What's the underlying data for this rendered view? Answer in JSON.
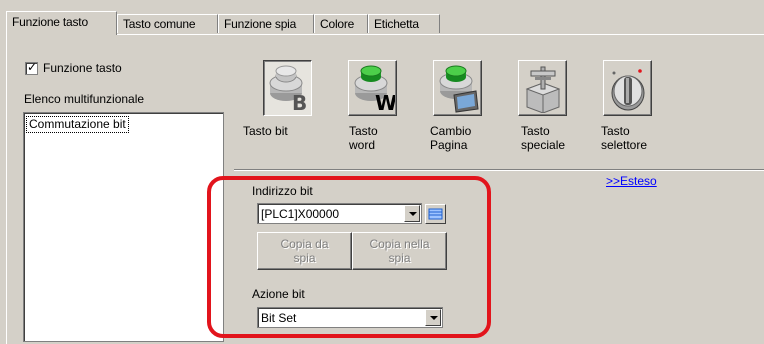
{
  "tabs": [
    {
      "label": "Funzione tasto",
      "active": true
    },
    {
      "label": "Tasto comune",
      "active": false
    },
    {
      "label": "Funzione spia",
      "active": false
    },
    {
      "label": "Colore",
      "active": false
    },
    {
      "label": "Etichetta",
      "active": false
    }
  ],
  "left": {
    "checkbox_label": "Funzione tasto",
    "checkbox_checked": true,
    "list_title": "Elenco multifunzionale",
    "list_items": [
      "Commutazione bit"
    ]
  },
  "key_types": [
    {
      "line1": "Tasto bit",
      "line2": "",
      "icon": "bit-key-icon",
      "selected": true
    },
    {
      "line1": "Tasto",
      "line2": "word",
      "icon": "word-key-icon",
      "selected": false
    },
    {
      "line1": "Cambio",
      "line2": "Pagina",
      "icon": "page-change-icon",
      "selected": false
    },
    {
      "line1": "Tasto",
      "line2": "speciale",
      "icon": "special-key-icon",
      "selected": false
    },
    {
      "line1": "Tasto",
      "line2": "selettore",
      "icon": "selector-key-icon",
      "selected": false
    }
  ],
  "extended_link": ">>Esteso",
  "bit_address": {
    "label": "Indirizzo bit",
    "value": "[PLC1]X00000"
  },
  "buttons": {
    "copy_from_line1": "Copia da",
    "copy_from_line2": "spia",
    "copy_to_line1": "Copia nella",
    "copy_to_line2": "spia"
  },
  "bit_action": {
    "label": "Azione bit",
    "value": "Bit Set"
  },
  "colors": {
    "highlight": "#e2141c",
    "link": "#0000ff",
    "background": "#d4d0c8"
  }
}
